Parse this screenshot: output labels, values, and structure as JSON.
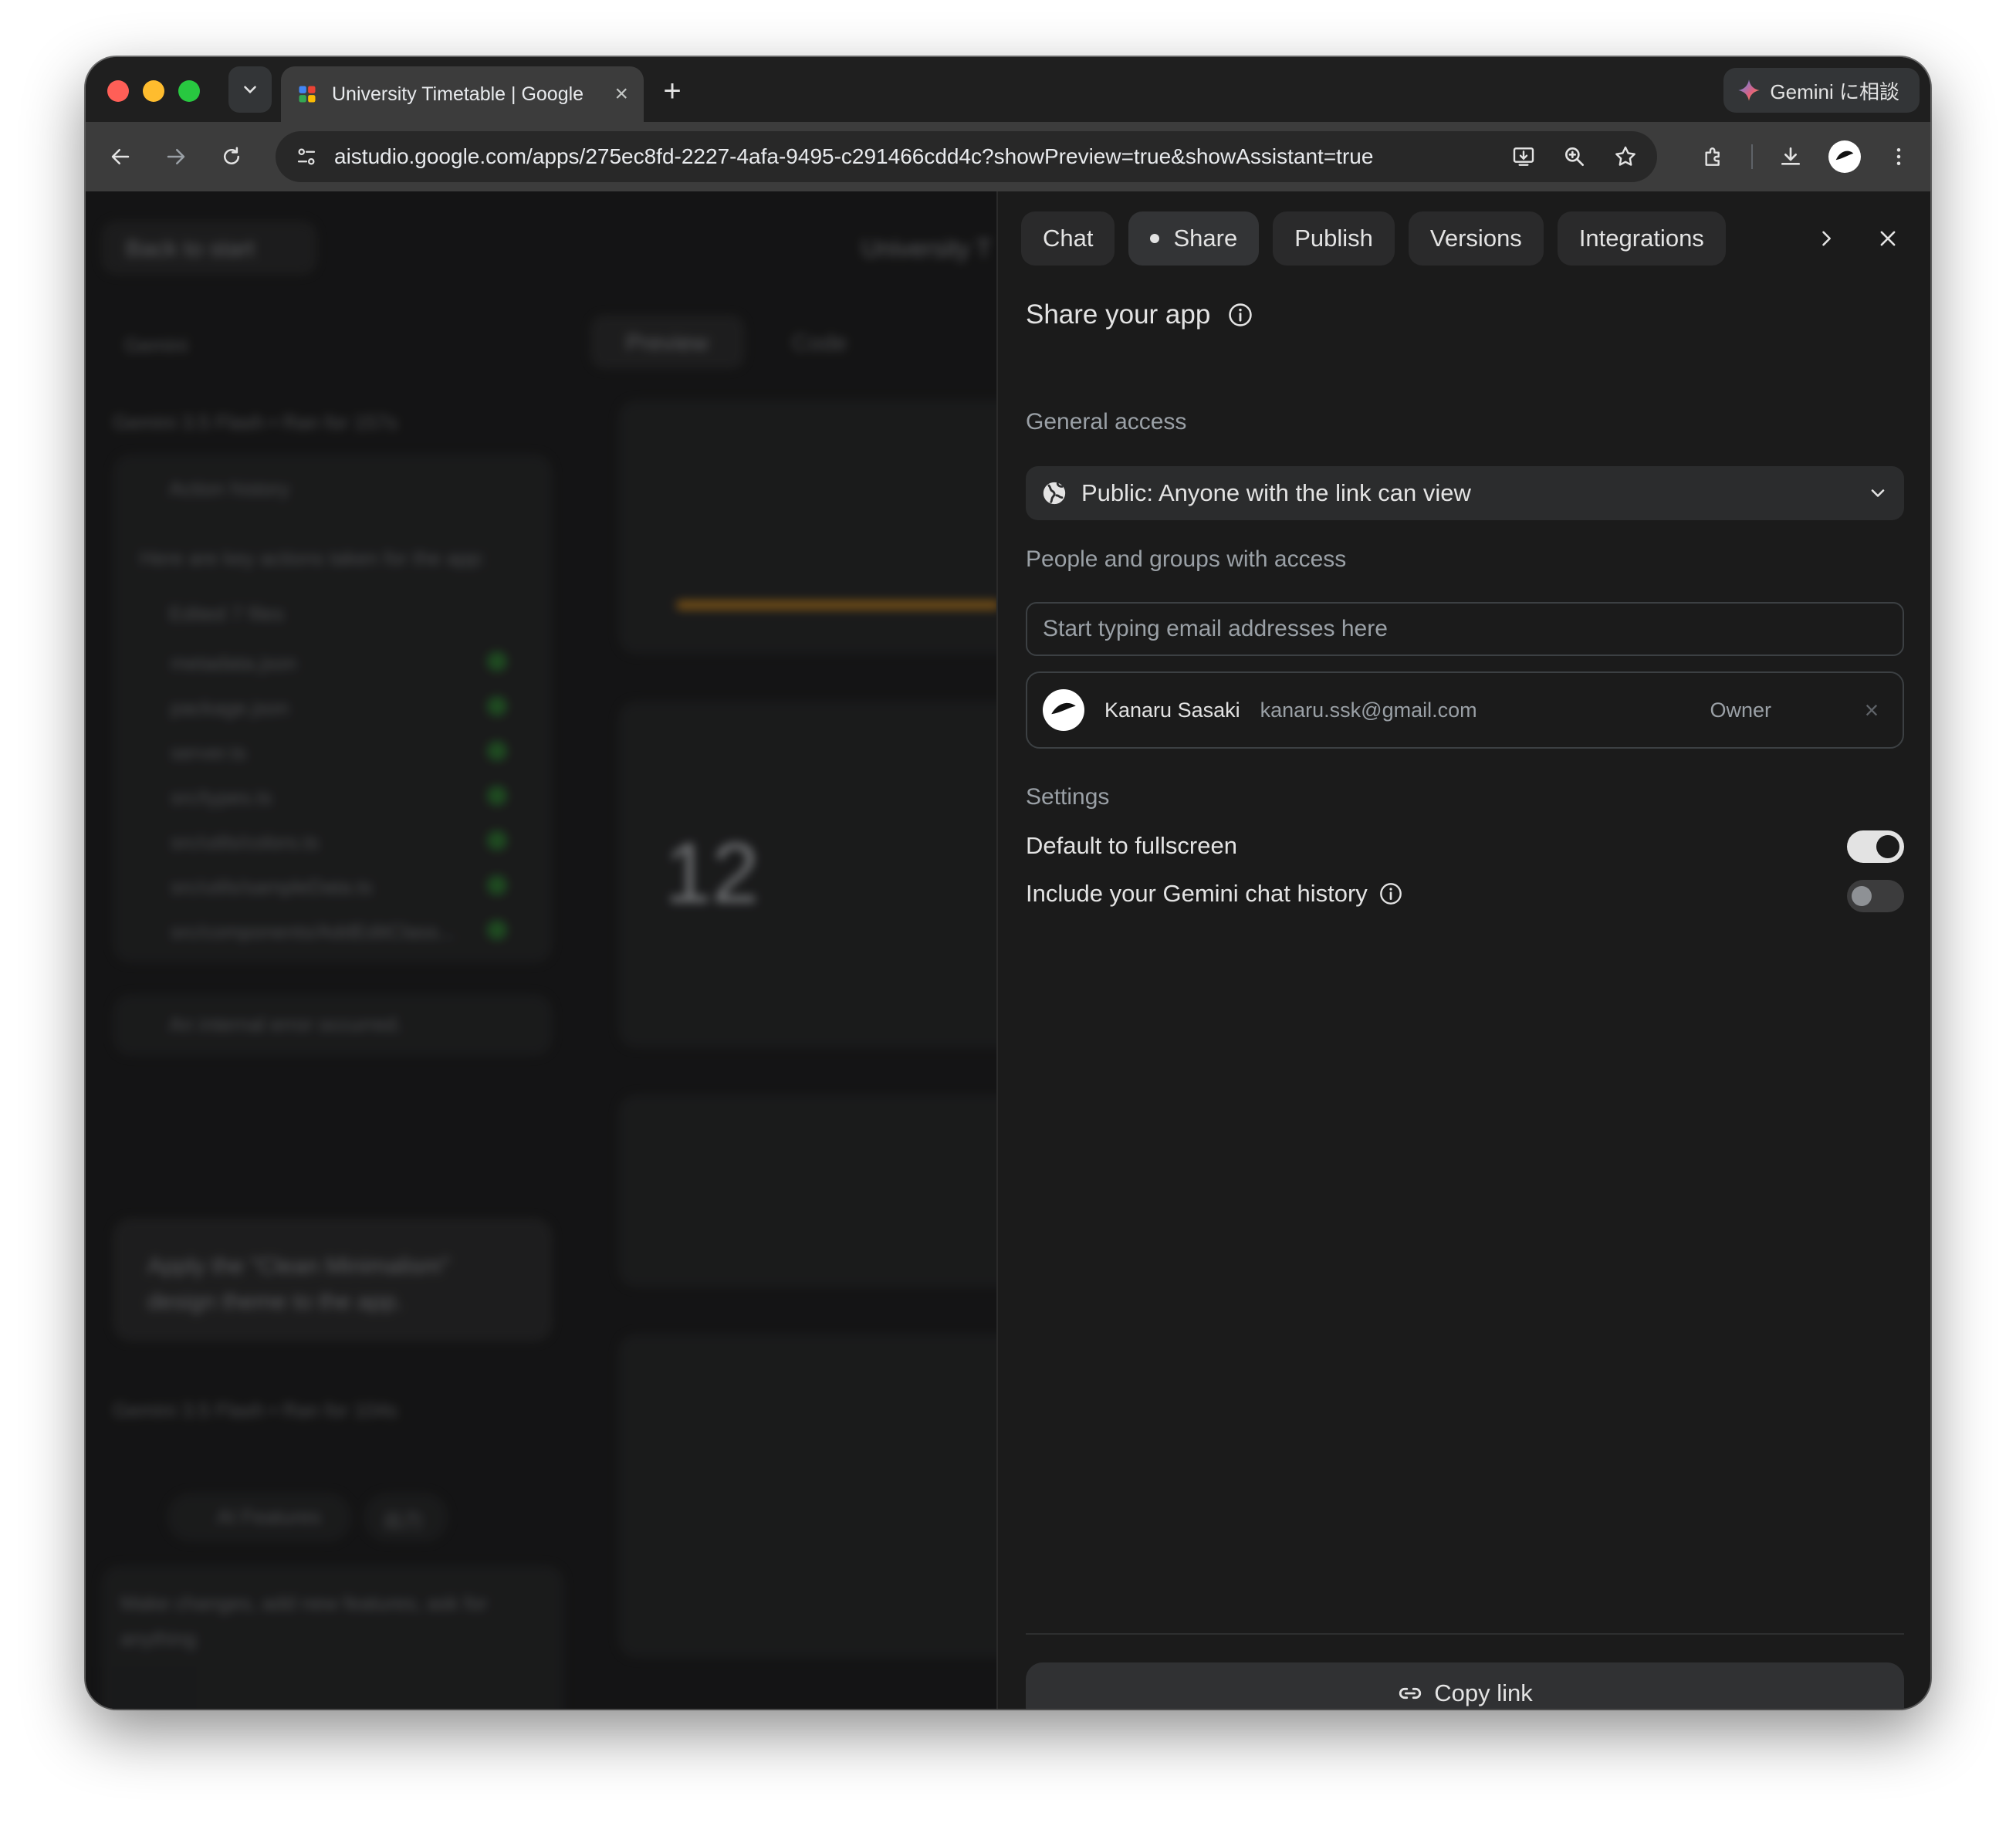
{
  "browser": {
    "tab_title": "University Timetable | Google",
    "gemini_button": "Gemini に相談",
    "url": "aistudio.google.com/apps/275ec8fd-2227-4afa-9495-c291466cdd4c?showPreview=true&showAssistant=true"
  },
  "background_app": {
    "back_button": "Back to start",
    "title": "University T",
    "sidebar_label": "Gemini",
    "model_line_1": "Gemini 3.5 Flash  •  Ran for 157s",
    "action_history": "Action history",
    "action_intro": "Here are key actions taken for the app:",
    "edited": "Edited 7 files",
    "files": [
      "metadata.json",
      "package.json",
      "server.ts",
      "src/types.ts",
      "src/utils/colors.ts",
      "src/utils/sampleData.ts",
      "src/components/AddEditClass..."
    ],
    "error": "An internal error occurred.",
    "prompt": "Apply the \"Clean Minimalism\" design theme to the app.",
    "model_line_2": "Gemini 3.5 Flash  •  Ran for 104s",
    "chip_ai": "AI Features",
    "chip_other": "出力",
    "input_placeholder": "Make changes, add new features, ask for anything",
    "preview_tab": "Preview",
    "code_tab": "Code",
    "big_number": "12"
  },
  "panel": {
    "tabs": [
      "Chat",
      "Share",
      "Publish",
      "Versions",
      "Integrations"
    ],
    "active_tab": "Share",
    "heading": "Share your app",
    "general_access_label": "General access",
    "access_value": "Public: Anyone with the link can view",
    "people_label": "People and groups with access",
    "email_placeholder": "Start typing email addresses here",
    "owner": {
      "name": "Kanaru Sasaki",
      "email": "kanaru.ssk@gmail.com",
      "role": "Owner"
    },
    "settings_label": "Settings",
    "settings": [
      {
        "label": "Default to fullscreen",
        "enabled": true
      },
      {
        "label": "Include your Gemini chat history",
        "enabled": false
      }
    ],
    "copy_link": "Copy link"
  }
}
